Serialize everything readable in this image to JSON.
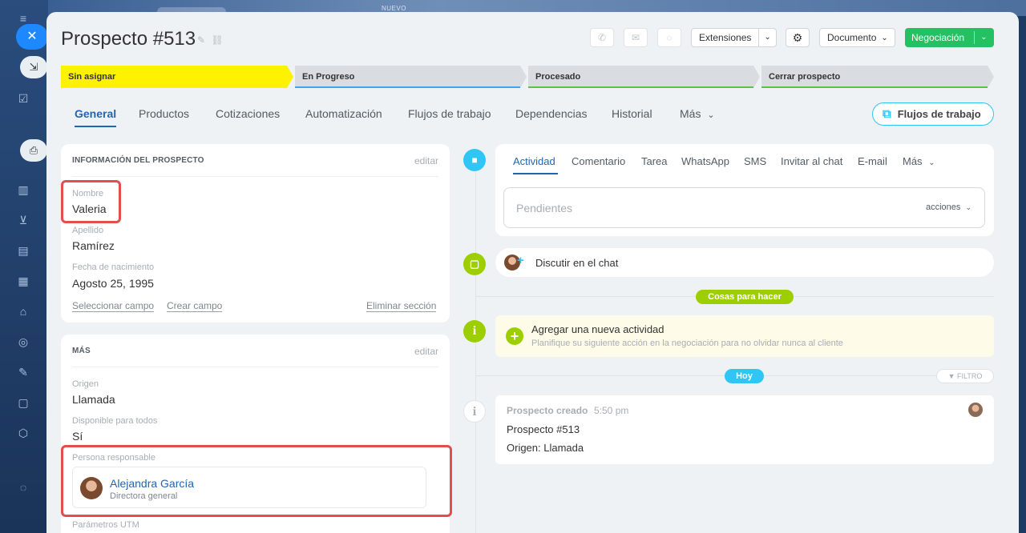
{
  "background": {
    "new_label": "NUEVO"
  },
  "header": {
    "title": "Prospecto #513",
    "extensions_label": "Extensiones",
    "document_label": "Documento",
    "primary_label": "Negociación"
  },
  "stages": [
    {
      "label": "Sin asignar",
      "color": "#fff200",
      "bar": "#fff200"
    },
    {
      "label": "En Progreso",
      "color": "#d9dde1",
      "bar": "#39a8ef"
    },
    {
      "label": "Procesado",
      "color": "#d9dde1",
      "bar": "#59c43c"
    },
    {
      "label": "Cerrar prospecto",
      "color": "#d9dde1",
      "bar": "#59c43c"
    }
  ],
  "tabs": [
    "General",
    "Productos",
    "Cotizaciones",
    "Automatización",
    "Flujos de trabajo",
    "Dependencias",
    "Historial",
    "Más"
  ],
  "workflows_button": "Flujos de trabajo",
  "lead_info": {
    "title": "INFORMACIÓN DEL PROSPECTO",
    "edit": "editar",
    "fields": [
      {
        "label": "Nombre",
        "value": "Valeria"
      },
      {
        "label": "Apellido",
        "value": "Ramírez"
      },
      {
        "label": "Fecha de nacimiento",
        "value": "Agosto 25, 1995"
      }
    ],
    "select_field": "Seleccionar campo",
    "create_field": "Crear campo",
    "delete_section": "Eliminar sección"
  },
  "more_section": {
    "title": "MÁS",
    "edit": "editar",
    "fields": [
      {
        "label": "Origen",
        "value": "Llamada"
      },
      {
        "label": "Disponible para todos",
        "value": "Sí"
      }
    ],
    "responsible_label": "Persona responsable",
    "responsible_name": "Alejandra García",
    "responsible_role": "Directora general",
    "utm_label": "Parámetros UTM"
  },
  "activity": {
    "tabs": [
      "Actividad",
      "Comentario",
      "Tarea",
      "WhatsApp",
      "SMS",
      "Invitar al chat",
      "E-mail",
      "Más"
    ],
    "placeholder": "Pendientes",
    "actions": "acciones"
  },
  "chat": {
    "label": "Discutir en el chat"
  },
  "todo_badge": "Cosas para hacer",
  "new_activity": {
    "title": "Agregar una nueva actividad",
    "subtitle": "Planifique su siguiente acción en la negociación para no olvidar nunca al cliente"
  },
  "today_badge": "Hoy",
  "filter_label": "FILTRO",
  "event": {
    "title": "Prospecto creado",
    "time": "5:50 pm",
    "line1": "Prospecto #513",
    "line2": "Origen: Llamada"
  }
}
